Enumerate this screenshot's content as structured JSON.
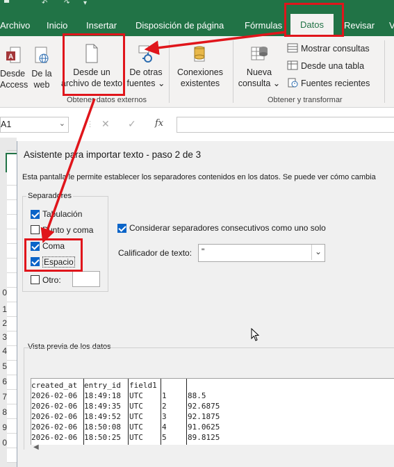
{
  "tabs": [
    "Archivo",
    "Inicio",
    "Insertar",
    "Disposición de página",
    "Fórmulas",
    "Datos",
    "Revisar",
    "V"
  ],
  "ribbon": {
    "from_access": [
      "Desde",
      "Access"
    ],
    "from_web": [
      "De la",
      "web"
    ],
    "from_text": [
      "Desde un",
      "archivo de texto"
    ],
    "other_sources": [
      "De otras",
      "fuentes"
    ],
    "existing_connections": [
      "Conexiones",
      "existentes"
    ],
    "new_query": [
      "Nueva",
      "consulta"
    ],
    "show_queries": "Mostrar consultas",
    "from_table": "Desde una tabla",
    "recent_sources": "Fuentes recientes",
    "group_external": "Obtener datos externos",
    "group_transform": "Obtener y transformar"
  },
  "formula_bar": {
    "name_box": "A1",
    "fx": "fx"
  },
  "row_headers": [
    "0",
    "1",
    "2",
    "3",
    "4",
    "5",
    "6",
    "7",
    "8",
    "9",
    "0"
  ],
  "dialog": {
    "title": "Asistente para importar texto - paso 2 de 3",
    "description": "Esta pantalla le permite establecer los separadores contenidos en los datos. Se puede ver cómo cambia",
    "separators_label": "Separadores",
    "tab_label": "Tabulación",
    "semicolon_label": "Punto y coma",
    "comma_label": "Coma",
    "space_label": "Espacio",
    "other_label": "Otro:",
    "consecutive_label": "Considerar separadores consecutivos como uno solo",
    "qualifier_label": "Calificador de texto:",
    "qualifier_value": "\"",
    "preview_label": "Vista previa de los datos",
    "checkbox_states": {
      "tab": true,
      "semicolon": false,
      "comma": true,
      "space": true,
      "other": false,
      "consecutive": true
    }
  },
  "preview": {
    "headers": [
      "created_at",
      "entry_id",
      "field1",
      "",
      ""
    ],
    "rows": [
      [
        "2026-02-06",
        "18:49:18",
        "UTC",
        "1",
        "88.5"
      ],
      [
        "2026-02-06",
        "18:49:35",
        "UTC",
        "2",
        "92.6875"
      ],
      [
        "2026-02-06",
        "18:49:52",
        "UTC",
        "3",
        "92.1875"
      ],
      [
        "2026-02-06",
        "18:50:08",
        "UTC",
        "4",
        "91.0625"
      ],
      [
        "2026-02-06",
        "18:50:25",
        "UTC",
        "5",
        "89.8125"
      ]
    ]
  },
  "colors": {
    "excel_green": "#217346",
    "highlight_red": "#e0151b",
    "check_blue": "#0a64c8"
  }
}
